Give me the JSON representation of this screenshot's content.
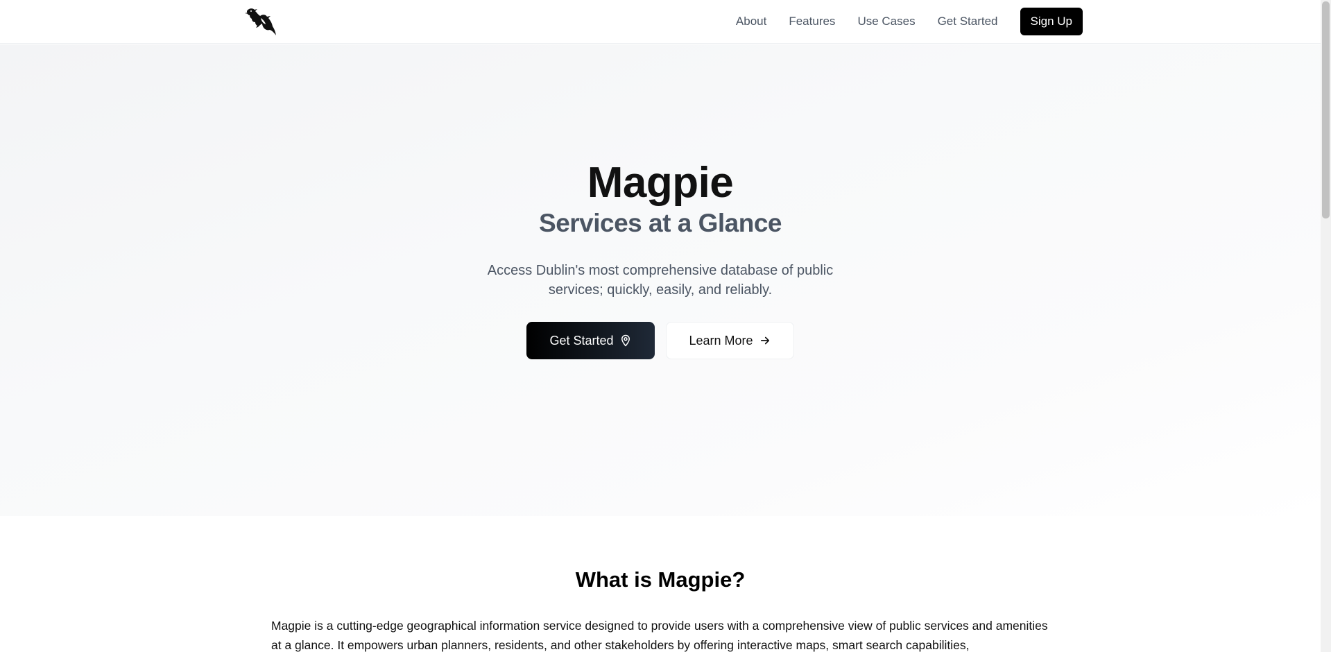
{
  "header": {
    "logo_icon": "magpie-bird-logo",
    "nav": {
      "about": "About",
      "features": "Features",
      "use_cases": "Use Cases",
      "get_started": "Get Started"
    },
    "signup_label": "Sign Up"
  },
  "hero": {
    "title": "Magpie",
    "subtitle": "Services at a Glance",
    "description": "Access Dublin's most comprehensive database of public services; quickly, easily, and reliably.",
    "primary_button": {
      "label": "Get Started",
      "icon": "map-pin-icon"
    },
    "secondary_button": {
      "label": "Learn More",
      "icon": "arrow-right-icon"
    }
  },
  "about": {
    "title": "What is Magpie?",
    "text": "Magpie is a cutting-edge geographical information service designed to provide users with a comprehensive view of public services and amenities at a glance. It empowers urban planners, residents, and other stakeholders by offering interactive maps, smart search capabilities,"
  },
  "colors": {
    "primary": "#000000",
    "muted_text": "#4b5563",
    "background": "#ffffff"
  }
}
